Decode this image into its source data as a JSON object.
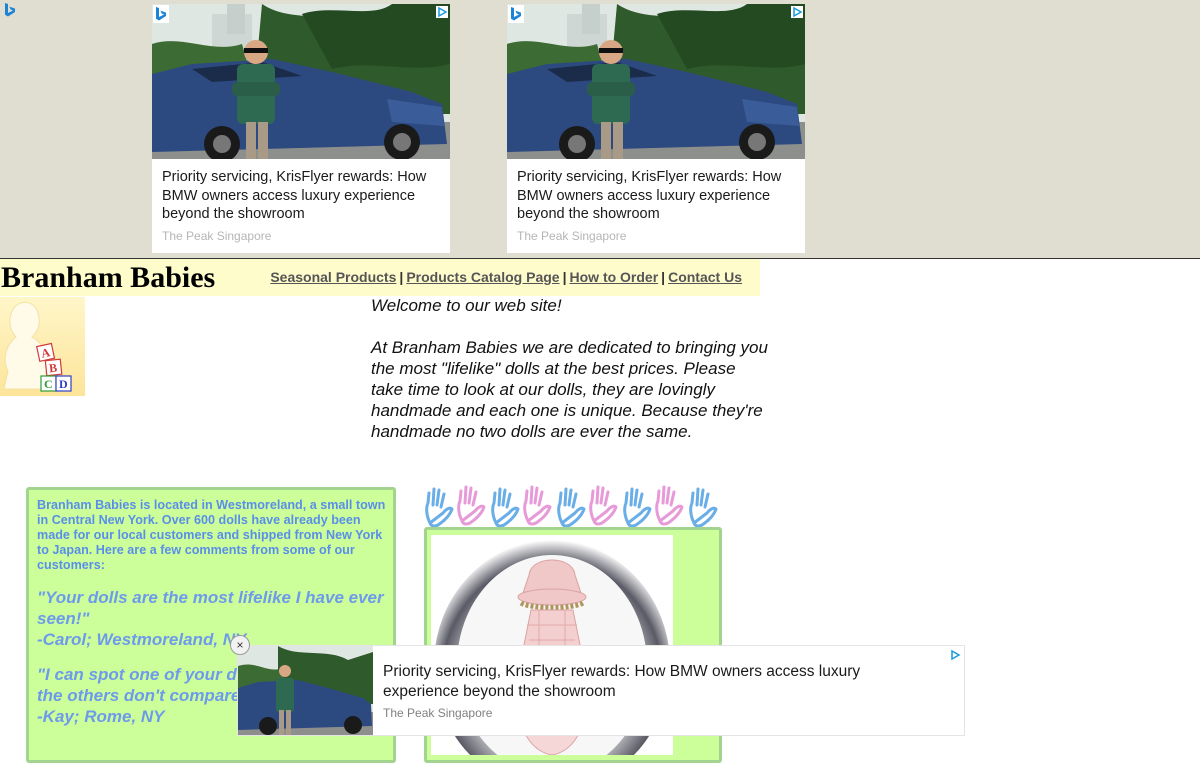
{
  "ads": {
    "cards": [
      {
        "headline": "Priority servicing, KrisFlyer rewards: How BMW owners access luxury experience beyond the showroom",
        "source": "The Peak Singapore"
      },
      {
        "headline": "Priority servicing, KrisFlyer rewards: How BMW owners access luxury experience beyond the showroom",
        "source": "The Peak Singapore"
      }
    ],
    "sticky": {
      "headline": "Priority servicing, KrisFlyer rewards: How BMW owners access luxury experience beyond the showroom",
      "source": "The Peak Singapore",
      "close_label": "×"
    },
    "icons": {
      "brand": "bing-icon",
      "adchoices": "adchoices-icon",
      "close": "close-icon"
    }
  },
  "header": {
    "site_title": "Branham Babies",
    "nav": [
      {
        "label": "Seasonal Products"
      },
      {
        "label": "Products Catalog Page"
      },
      {
        "label": "How to Order"
      },
      {
        "label": "Contact Us"
      }
    ],
    "separator": "|"
  },
  "logo": {
    "blocks": [
      "A",
      "B",
      "C",
      "D"
    ]
  },
  "welcome": {
    "heading": "Welcome to our web site!",
    "body": "At Branham Babies we are dedicated to bringing you the most \"lifelike\" dolls at the best prices. Please take time to look at our dolls, they are lovingly handmade and each one is unique. Because they're handmade no two dolls are ever the same."
  },
  "info": {
    "intro": "Branham Babies is located in Westmoreland, a small town in Central New York. Over 600 dolls have already been made for our local customers and shipped from New York to Japan. Here are a few comments from some of our customers:",
    "quotes": [
      {
        "text": "\"Your dolls are the most lifelike I have ever seen!\"",
        "author": "-Carol; Westmoreland, NY"
      },
      {
        "text": "\"I can spot one of your dolls in a crowd, the others don't compare!\"",
        "author": "-Kay; Rome, NY"
      }
    ]
  },
  "colors": {
    "ad_band": "#e0ddd1",
    "header_bg": "#fffccc",
    "green_box": "#ccff99",
    "green_border": "#a3d48f",
    "info_text": "#5a8ee8"
  }
}
